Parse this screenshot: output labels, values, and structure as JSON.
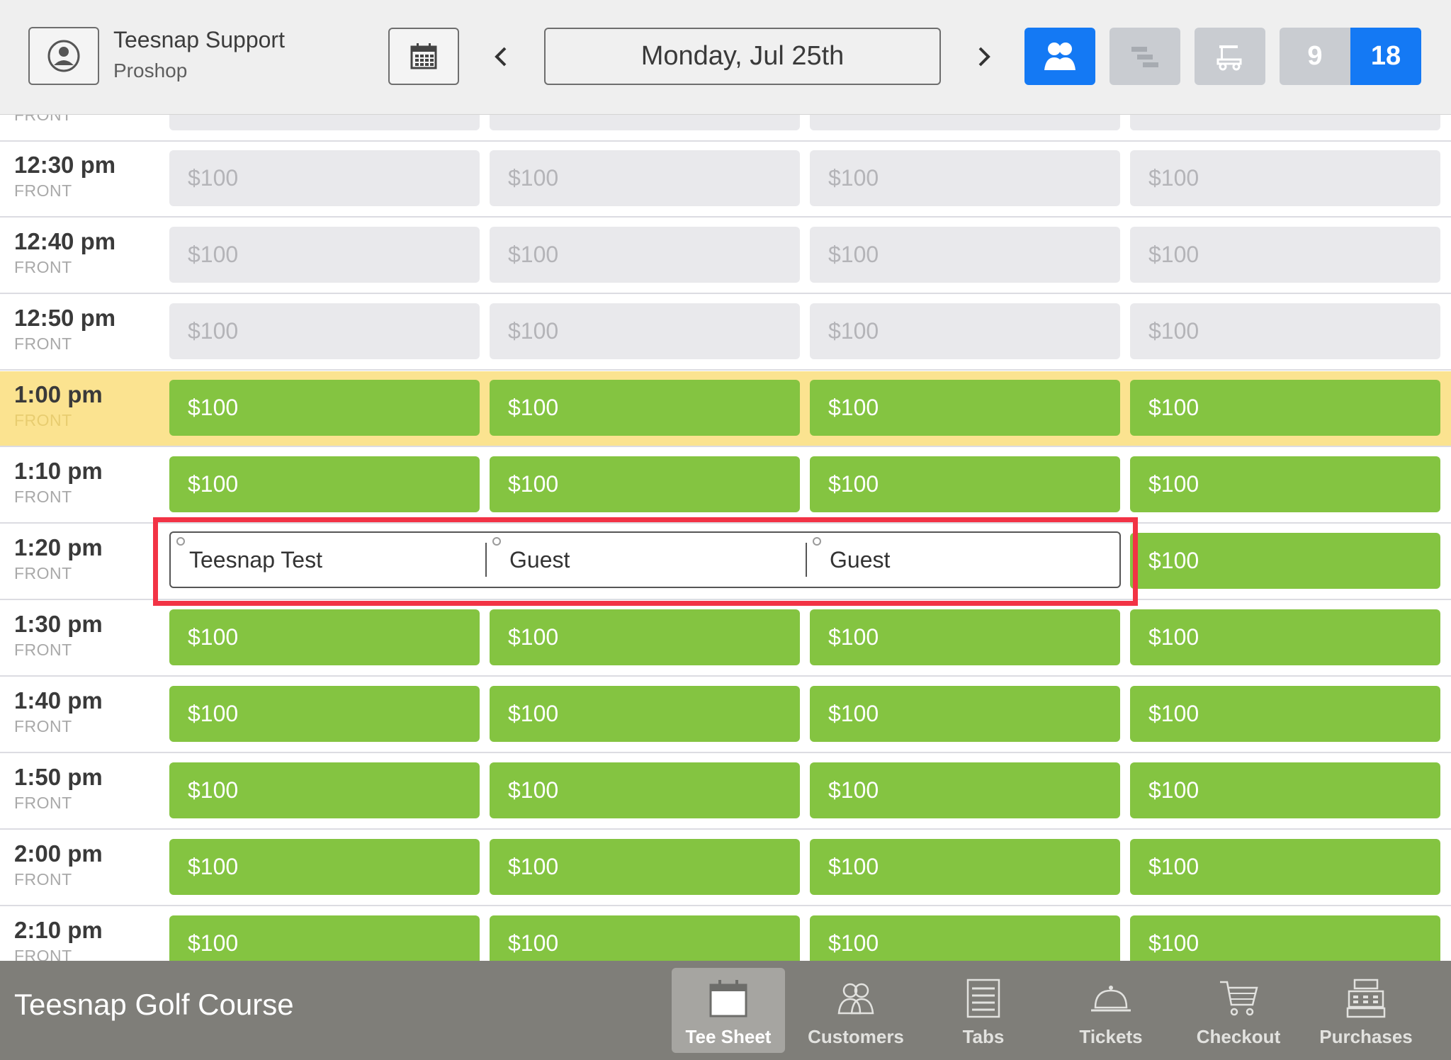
{
  "header": {
    "user_name": "Teesnap Support",
    "user_role": "Proshop",
    "date": "Monday, Jul 25th",
    "holes_9": "9",
    "holes_18": "18",
    "accent_color": "#1479f4"
  },
  "sheet": {
    "partial_top_side": "FRONT",
    "rows": [
      {
        "time": "12:30 pm",
        "side": "FRONT",
        "slots": [
          "$100",
          "$100",
          "$100",
          "$100"
        ],
        "status": "unavailable"
      },
      {
        "time": "12:40 pm",
        "side": "FRONT",
        "slots": [
          "$100",
          "$100",
          "$100",
          "$100"
        ],
        "status": "unavailable"
      },
      {
        "time": "12:50 pm",
        "side": "FRONT",
        "slots": [
          "$100",
          "$100",
          "$100",
          "$100"
        ],
        "status": "unavailable"
      },
      {
        "time": "1:00 pm",
        "side": "FRONT",
        "slots": [
          "$100",
          "$100",
          "$100",
          "$100"
        ],
        "status": "open",
        "highlight": true
      },
      {
        "time": "1:10 pm",
        "side": "FRONT",
        "slots": [
          "$100",
          "$100",
          "$100",
          "$100"
        ],
        "status": "open"
      },
      {
        "time": "1:20 pm",
        "side": "FRONT",
        "players": [
          "Teesnap Test",
          "Guest",
          "Guest"
        ],
        "slots": [
          "$100"
        ],
        "status": "booked"
      },
      {
        "time": "1:30 pm",
        "side": "FRONT",
        "slots": [
          "$100",
          "$100",
          "$100",
          "$100"
        ],
        "status": "open"
      },
      {
        "time": "1:40 pm",
        "side": "FRONT",
        "slots": [
          "$100",
          "$100",
          "$100",
          "$100"
        ],
        "status": "open"
      },
      {
        "time": "1:50 pm",
        "side": "FRONT",
        "slots": [
          "$100",
          "$100",
          "$100",
          "$100"
        ],
        "status": "open"
      },
      {
        "time": "2:00 pm",
        "side": "FRONT",
        "slots": [
          "$100",
          "$100",
          "$100",
          "$100"
        ],
        "status": "open"
      },
      {
        "time": "2:10 pm",
        "side": "FRONT",
        "slots": [
          "$100",
          "$100",
          "$100",
          "$100"
        ],
        "status": "open"
      }
    ],
    "colors": {
      "open": "#84c441",
      "unavailable": "#e9e9ec",
      "highlight": "#fbe390",
      "selection": "#f23345"
    }
  },
  "footer": {
    "course_name": "Teesnap Golf Course",
    "tabs": [
      {
        "label": "Tee Sheet",
        "icon": "calendar-icon",
        "active": true
      },
      {
        "label": "Customers",
        "icon": "customers-icon"
      },
      {
        "label": "Tabs",
        "icon": "receipt-icon"
      },
      {
        "label": "Tickets",
        "icon": "service-bell-icon"
      },
      {
        "label": "Checkout",
        "icon": "cart-icon"
      },
      {
        "label": "Purchases",
        "icon": "cash-register-icon"
      }
    ]
  }
}
